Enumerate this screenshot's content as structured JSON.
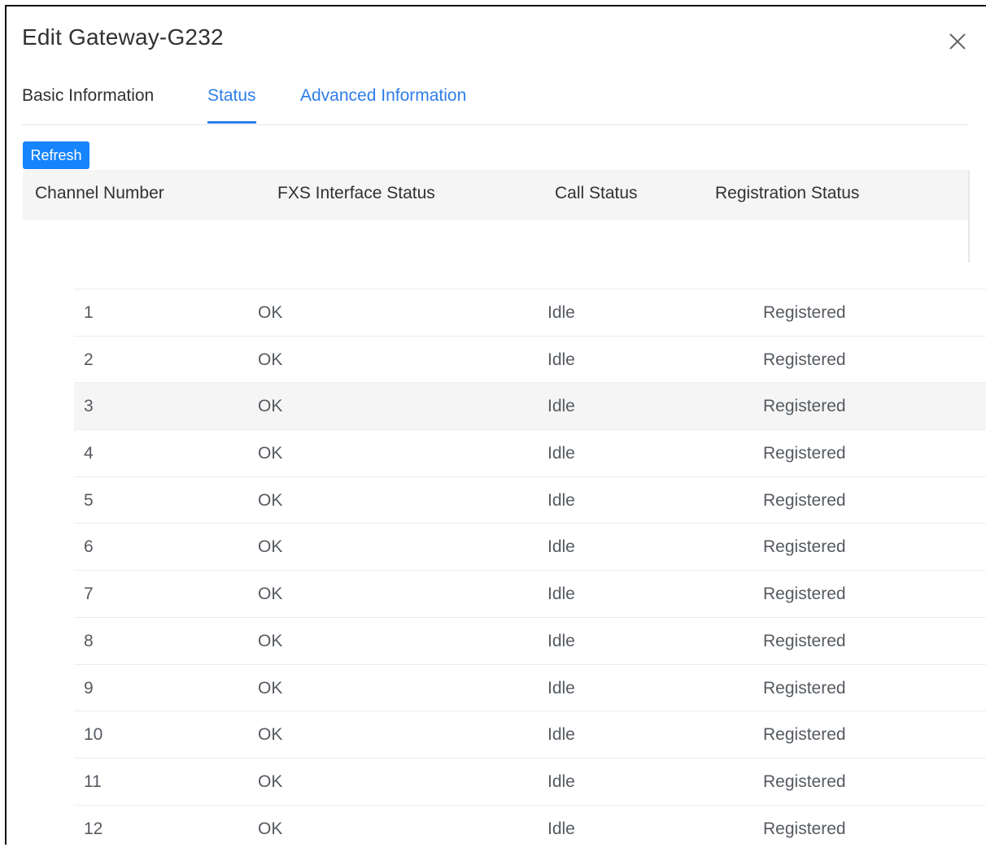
{
  "dialog": {
    "title": "Edit Gateway-G232"
  },
  "tabs": [
    {
      "label": "Basic Information",
      "active": false
    },
    {
      "label": "Status",
      "active": true
    },
    {
      "label": "Advanced Information",
      "active": false
    }
  ],
  "toolbar": {
    "refresh_label": "Refresh"
  },
  "colors": {
    "accent": "#2f7ee8",
    "button": "#1684fc",
    "header_bg": "#f5f5f5"
  },
  "table": {
    "columns": [
      "Channel Number",
      "FXS Interface Status",
      "Call Status",
      "Registration Status"
    ],
    "rows": [
      {
        "channel": "1",
        "fxs": "OK",
        "call": "Idle",
        "registration": "Registered"
      },
      {
        "channel": "2",
        "fxs": "OK",
        "call": "Idle",
        "registration": "Registered"
      },
      {
        "channel": "3",
        "fxs": "OK",
        "call": "Idle",
        "registration": "Registered"
      },
      {
        "channel": "4",
        "fxs": "OK",
        "call": "Idle",
        "registration": "Registered"
      },
      {
        "channel": "5",
        "fxs": "OK",
        "call": "Idle",
        "registration": "Registered"
      },
      {
        "channel": "6",
        "fxs": "OK",
        "call": "Idle",
        "registration": "Registered"
      },
      {
        "channel": "7",
        "fxs": "OK",
        "call": "Idle",
        "registration": "Registered"
      },
      {
        "channel": "8",
        "fxs": "OK",
        "call": "Idle",
        "registration": "Registered"
      },
      {
        "channel": "9",
        "fxs": "OK",
        "call": "Idle",
        "registration": "Registered"
      },
      {
        "channel": "10",
        "fxs": "OK",
        "call": "Idle",
        "registration": "Registered"
      },
      {
        "channel": "11",
        "fxs": "OK",
        "call": "Idle",
        "registration": "Registered"
      },
      {
        "channel": "12",
        "fxs": "OK",
        "call": "Idle",
        "registration": "Registered"
      }
    ],
    "highlighted_row": 3
  }
}
